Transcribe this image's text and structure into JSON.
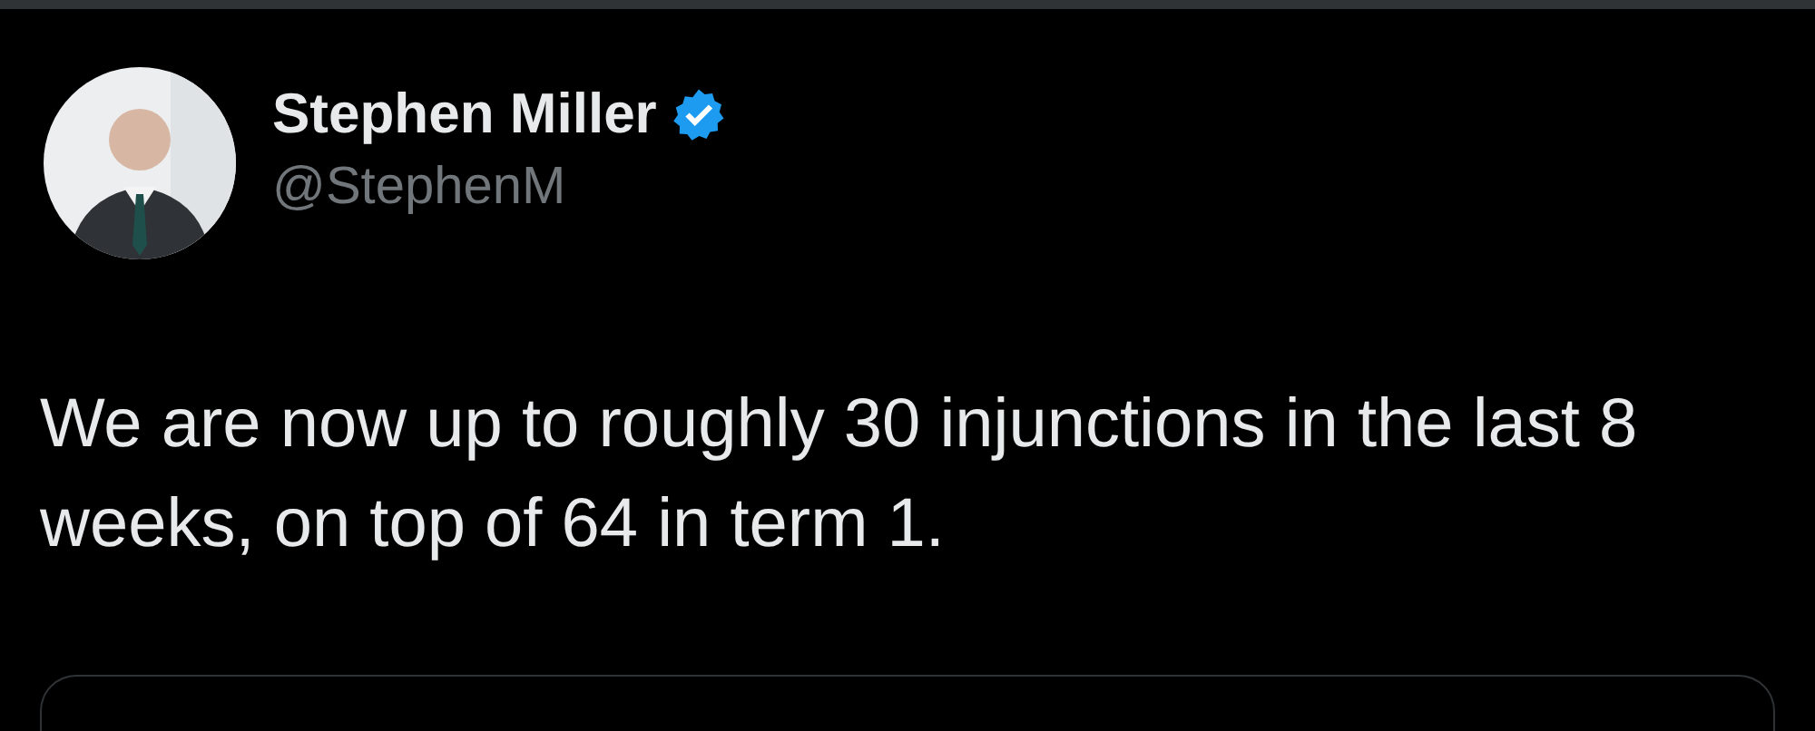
{
  "author": {
    "name": "Stephen Miller",
    "verified": true,
    "handle": "@StephenM"
  },
  "text": "We are now up to roughly 30 injunctions in the last 8 weeks, on top of 64 in term 1."
}
